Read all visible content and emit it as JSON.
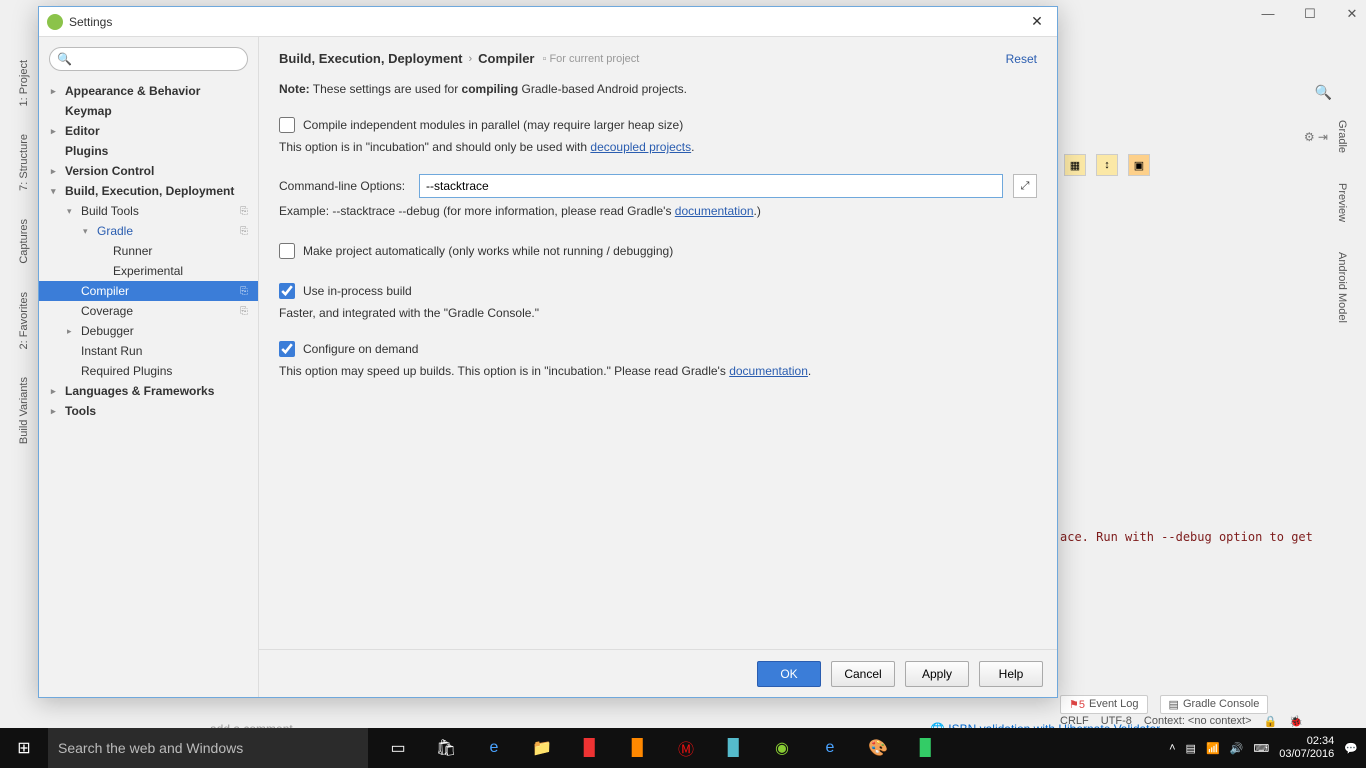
{
  "bg": {
    "left_tabs": [
      "1: Project",
      "7: Structure",
      "Captures",
      "2: Favorites",
      "Build Variants"
    ],
    "right_tabs": [
      "Gradle",
      "Preview",
      "Android Model"
    ],
    "console_text": "ace. Run with --debug option to get ",
    "event_log": "Event Log",
    "gradle_console": "Gradle Console",
    "status_crlf": "CRLF",
    "status_enc": "UTF-8",
    "status_ctx": "Context: <no context>",
    "add_comment": "add a comment",
    "isbn_link": "ISBN validation with Hibernate Validator"
  },
  "dialog": {
    "title": "Settings",
    "breadcrumb": [
      "Build, Execution, Deployment",
      "Compiler"
    ],
    "badge": "For current project",
    "reset": "Reset",
    "note_label": "Note:",
    "note_text": " These settings are used for ",
    "note_bold": "compiling",
    "note_tail": " Gradle-based Android projects.",
    "chk_parallel": "Compile independent modules in parallel (may require larger heap size)",
    "incubation_pre": "This option is in \"incubation\" and should only be used with ",
    "incubation_link": "decoupled projects",
    "cmd_label": "Command-line Options:",
    "cmd_value": "--stacktrace",
    "example_pre": "Example: --stacktrace --debug (for more information, please read Gradle's ",
    "example_link": "documentation",
    "example_post": ".)",
    "chk_auto": "Make project automatically (only works while not running / debugging)",
    "chk_inproc": "Use in-process build",
    "inproc_desc": "Faster, and integrated with the \"Gradle Console.\"",
    "chk_cod": "Configure on demand",
    "cod_desc_pre": "This option may speed up builds. This option is in \"incubation.\" Please read Gradle's ",
    "cod_link": "documentation",
    "btn_ok": "OK",
    "btn_cancel": "Cancel",
    "btn_apply": "Apply",
    "btn_help": "Help"
  },
  "tree": {
    "items": [
      {
        "label": "Appearance & Behavior",
        "bold": true,
        "arrow": "▸",
        "indent": 0
      },
      {
        "label": "Keymap",
        "bold": true,
        "indent": 0
      },
      {
        "label": "Editor",
        "bold": true,
        "arrow": "▸",
        "indent": 0
      },
      {
        "label": "Plugins",
        "bold": true,
        "indent": 0
      },
      {
        "label": "Version Control",
        "bold": true,
        "arrow": "▸",
        "indent": 0
      },
      {
        "label": "Build, Execution, Deployment",
        "bold": true,
        "arrow": "▾",
        "indent": 0
      },
      {
        "label": "Build Tools",
        "arrow": "▾",
        "indent": 1,
        "copy": true
      },
      {
        "label": "Gradle",
        "arrow": "▾",
        "indent": 2,
        "link": true,
        "copy": true
      },
      {
        "label": "Runner",
        "indent": 3
      },
      {
        "label": "Experimental",
        "indent": 3
      },
      {
        "label": "Compiler",
        "indent": 1,
        "selected": true,
        "copy": true
      },
      {
        "label": "Coverage",
        "indent": 1,
        "copy": true
      },
      {
        "label": "Debugger",
        "arrow": "▸",
        "indent": 1
      },
      {
        "label": "Instant Run",
        "indent": 1
      },
      {
        "label": "Required Plugins",
        "indent": 1
      },
      {
        "label": "Languages & Frameworks",
        "bold": true,
        "arrow": "▸",
        "indent": 0
      },
      {
        "label": "Tools",
        "bold": true,
        "arrow": "▸",
        "indent": 0
      }
    ]
  },
  "taskbar": {
    "search_placeholder": "Search the web and Windows",
    "time": "02:34",
    "date": "03/07/2016"
  }
}
